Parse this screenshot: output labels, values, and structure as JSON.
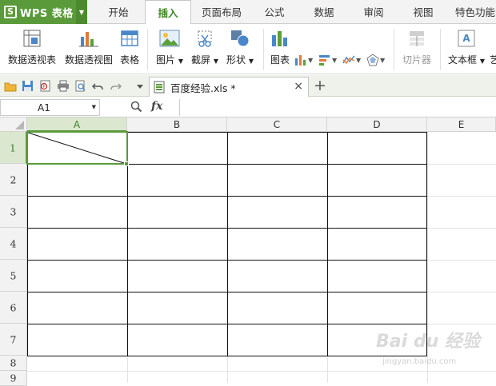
{
  "app": {
    "name": "WPS 表格",
    "logo_letter": "S",
    "accent_color": "#5a9a3a"
  },
  "menu_tabs": [
    {
      "label": "开始"
    },
    {
      "label": "插入",
      "active": true
    },
    {
      "label": "页面布局"
    },
    {
      "label": "公式"
    },
    {
      "label": "数据"
    },
    {
      "label": "审阅"
    },
    {
      "label": "视图"
    },
    {
      "label": "特色功能"
    }
  ],
  "ribbon": {
    "pivot_table": "数据透视表",
    "pivot_chart": "数据透视图",
    "table": "表格",
    "picture": "图片",
    "screenshot": "截屏",
    "shapes": "形状",
    "chart": "图表",
    "slicer": "切片器",
    "textbox": "文本框",
    "cut_off_char": "艺"
  },
  "quick_access": {
    "icons": [
      "open-folder-icon",
      "save-icon",
      "pdf-export-icon",
      "print-icon",
      "print-preview-icon",
      "undo-icon",
      "redo-icon",
      "customize-dropdown-icon"
    ]
  },
  "document_tab": {
    "filename": "百度经验.xls *",
    "close_glyph": "×",
    "new_tab_glyph": "+"
  },
  "formula_bar": {
    "cell_reference": "A1",
    "fx_label": "fx",
    "formula_value": ""
  },
  "sheet": {
    "columns": [
      "A",
      "B",
      "C",
      "D",
      "E"
    ],
    "rows": [
      "1",
      "2",
      "3",
      "4",
      "5",
      "6",
      "7",
      "8",
      "9"
    ],
    "selected_cell": "A1",
    "bordered_range": "A1:D7",
    "diagonal_border_cell": "A1"
  },
  "watermark": {
    "text": "Bai du 经验",
    "subtext": "jingyan.baidu.com"
  }
}
